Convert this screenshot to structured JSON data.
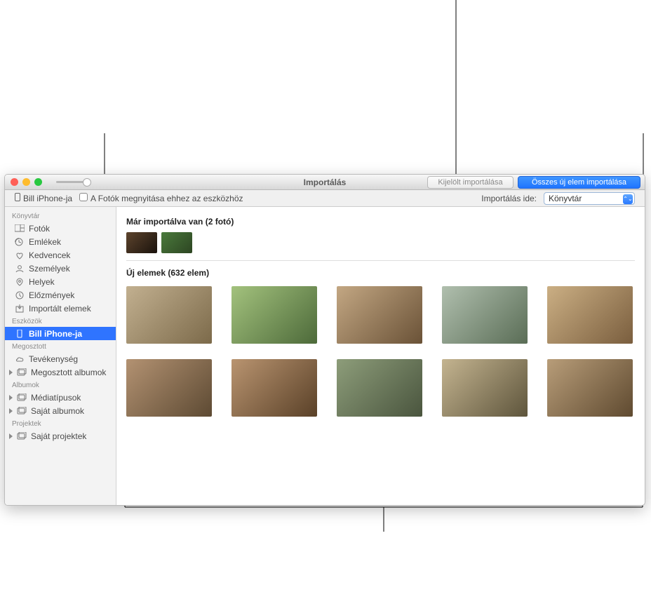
{
  "titlebar": {
    "title": "Importálás",
    "import_selected": "Kijelölt importálása",
    "import_all": "Összes új elem importálása"
  },
  "subtoolbar": {
    "device_name": "Bill iPhone-ja",
    "open_for_device": "A Fotók megnyitása ehhez az eszközhöz",
    "import_to_label": "Importálás ide:",
    "import_to_value": "Könyvtár"
  },
  "sidebar": {
    "library_header": "Könyvtár",
    "library_items": [
      "Fotók",
      "Emlékek",
      "Kedvencek",
      "Személyek",
      "Helyek",
      "Előzmények",
      "Importált elemek"
    ],
    "devices_header": "Eszközök",
    "devices_items": [
      "Bill iPhone-ja"
    ],
    "shared_header": "Megosztott",
    "shared_items": [
      "Tevékenység",
      "Megosztott albumok"
    ],
    "albums_header": "Albumok",
    "albums_items": [
      "Médiatípusok",
      "Saját albumok"
    ],
    "projects_header": "Projektek",
    "projects_items": [
      "Saját projektek"
    ]
  },
  "main": {
    "already_imported": "Már importálva van (2 fotó)",
    "new_items": "Új elemek (632 elem)"
  }
}
